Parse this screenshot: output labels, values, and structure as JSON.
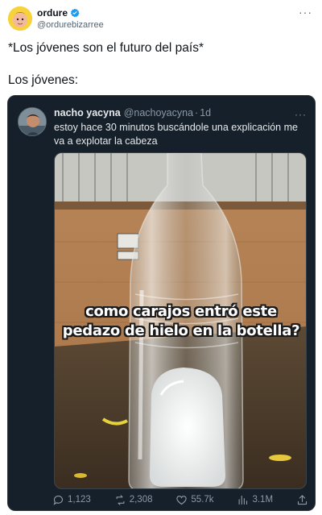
{
  "outer": {
    "name": "ordure",
    "handle": "@ordurebizarree",
    "line1": "*Los jóvenes son el futuro del país*",
    "line2": "Los jóvenes:"
  },
  "quoted": {
    "name": "nacho yacyna",
    "handle": "@nachoyacyna",
    "separator": "·",
    "time": "1d",
    "text": "estoy hace 30 minutos buscándole una explicación me va a explotar la cabeza",
    "caption_line1": "como carajos entró este",
    "caption_line2": "pedazo de hielo en la botella?",
    "stats": {
      "replies": "1,123",
      "reposts": "2,308",
      "likes": "55.7k",
      "views": "3.1M"
    }
  },
  "icons": {
    "outer_more": "more-icon",
    "verified": "verified-badge-icon",
    "reply": "reply-icon",
    "repost": "repost-icon",
    "like": "heart-icon",
    "views": "views-icon",
    "share": "share-icon"
  },
  "colors": {
    "verified": "#1d9bf0",
    "card_bg": "#15202b",
    "muted": "#8b98a5"
  }
}
